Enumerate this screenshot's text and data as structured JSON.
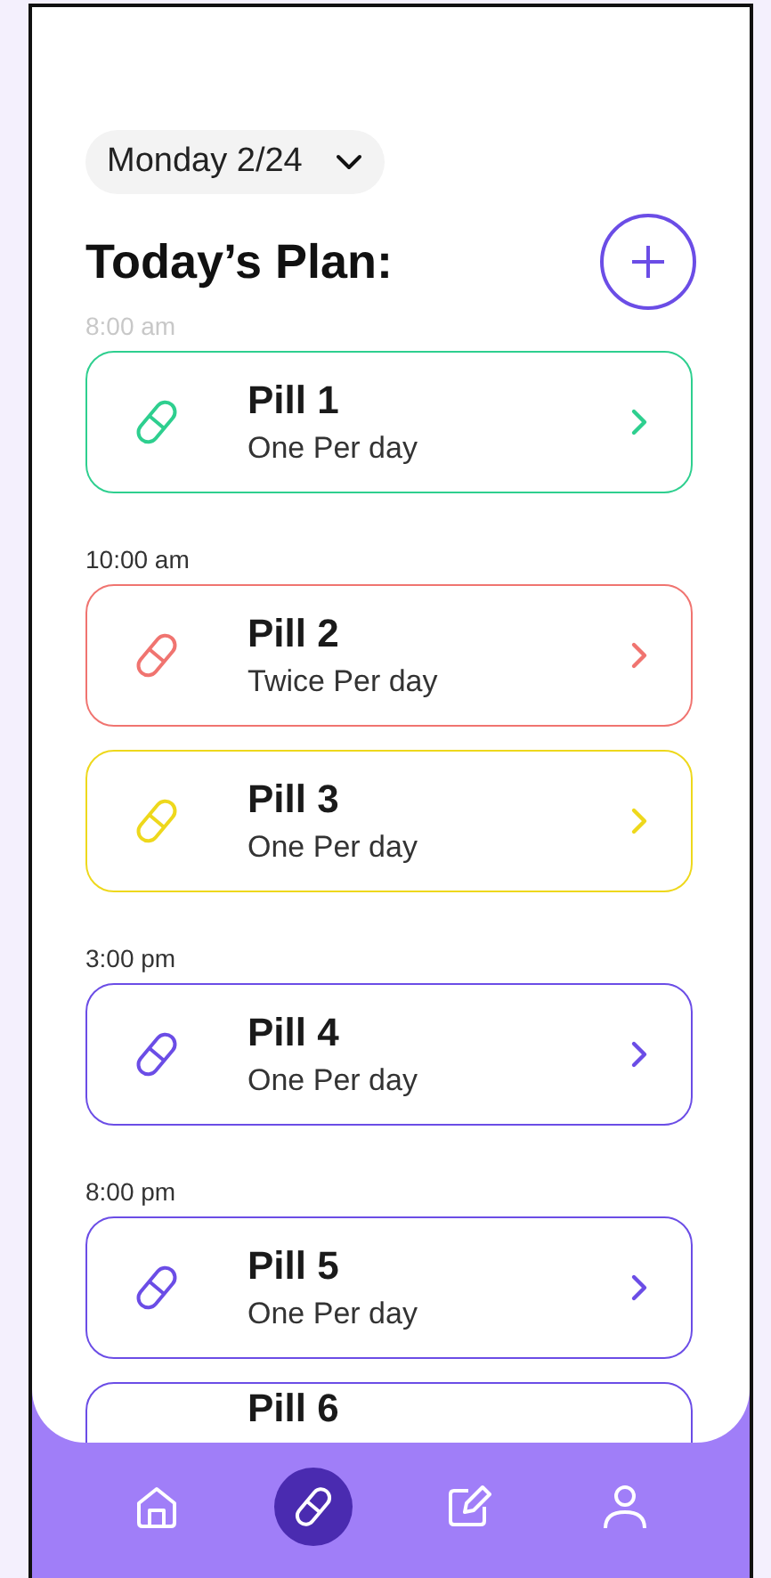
{
  "date_selector": {
    "label": "Monday 2/24"
  },
  "heading": "Today’s Plan:",
  "schedule": [
    {
      "time": "8:00 am",
      "faded": true,
      "pills": [
        {
          "name": "Pill 1",
          "dose": "One Per day",
          "color": "#2ecf8f"
        }
      ]
    },
    {
      "time": "10:00 am",
      "faded": false,
      "pills": [
        {
          "name": "Pill 2",
          "dose": "Twice Per day",
          "color": "#f07470"
        },
        {
          "name": "Pill 3",
          "dose": "One Per day",
          "color": "#eed81c"
        }
      ]
    },
    {
      "time": "3:00 pm",
      "faded": false,
      "pills": [
        {
          "name": "Pill 4",
          "dose": "One Per day",
          "color": "#6b4de6"
        }
      ]
    },
    {
      "time": "8:00 pm",
      "faded": false,
      "pills": [
        {
          "name": "Pill 5",
          "dose": "One Per day",
          "color": "#6b4de6"
        },
        {
          "name": "Pill 6",
          "color": "#6b4de6",
          "partial": true
        }
      ]
    }
  ],
  "nav": [
    {
      "kind": "home",
      "selected": false
    },
    {
      "kind": "pill",
      "selected": true
    },
    {
      "kind": "edit",
      "selected": false
    },
    {
      "kind": "profile",
      "selected": false
    }
  ]
}
